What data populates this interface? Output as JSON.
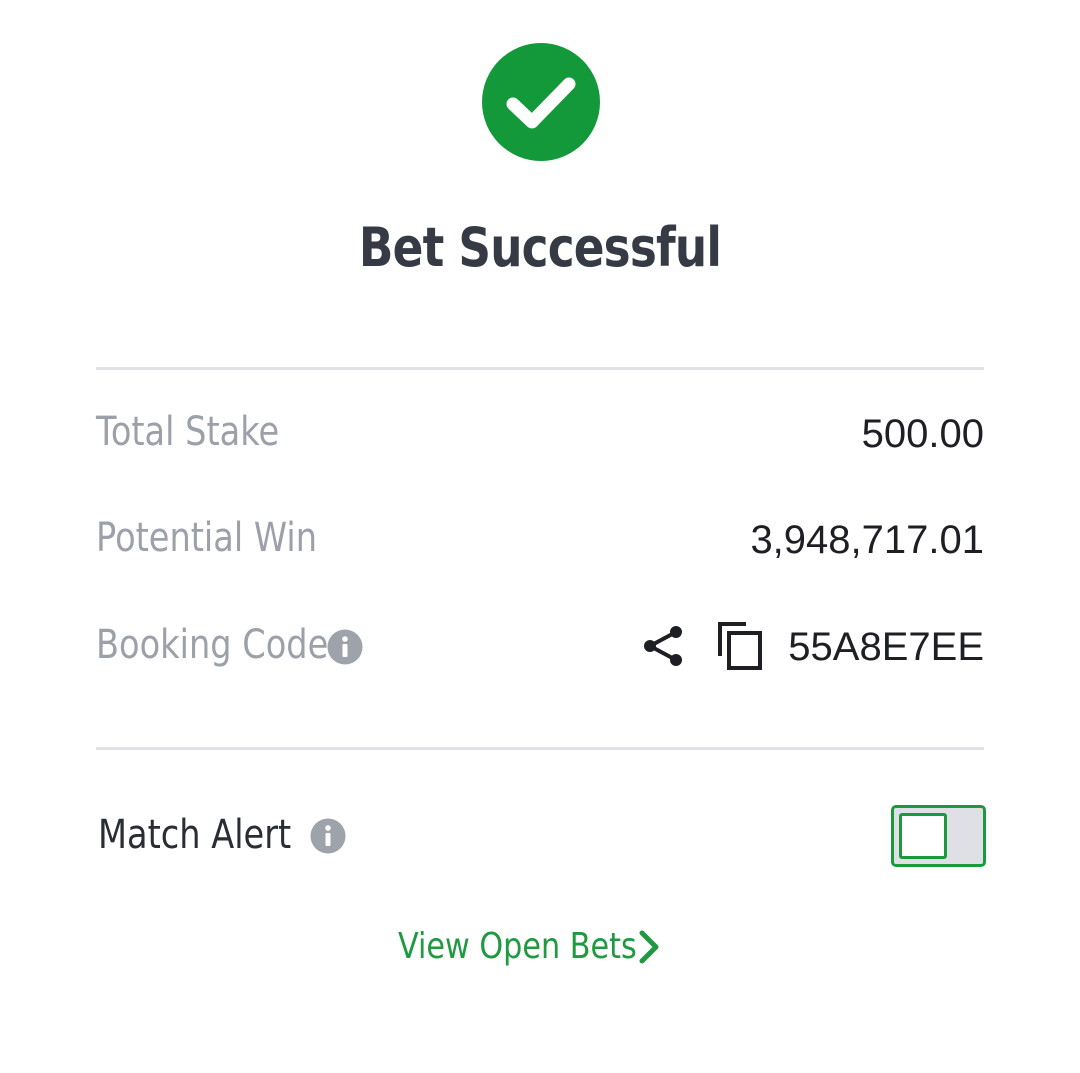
{
  "header": {
    "title": "Bet Successful"
  },
  "summary": {
    "total_stake_label": "Total Stake",
    "total_stake_value": "500.00",
    "potential_win_label": "Potential Win",
    "potential_win_value": "3,948,717.01",
    "booking_code_label": "Booking Code",
    "booking_code_value": "55A8E7EE"
  },
  "match_alert": {
    "label": "Match Alert",
    "enabled": false
  },
  "footer": {
    "view_open_bets_label": "View Open Bets"
  },
  "icons": {
    "success": "check-circle-icon",
    "info": "info-icon",
    "share": "share-icon",
    "copy": "copy-icon",
    "chevron": "chevron-right-icon"
  },
  "colors": {
    "brand_green": "#1a9a3c",
    "success_circle": "#13993a",
    "title_text": "#353a45",
    "muted_label": "#9ca0a9",
    "value_text": "#1d1f24",
    "divider": "#e1e2e7"
  }
}
